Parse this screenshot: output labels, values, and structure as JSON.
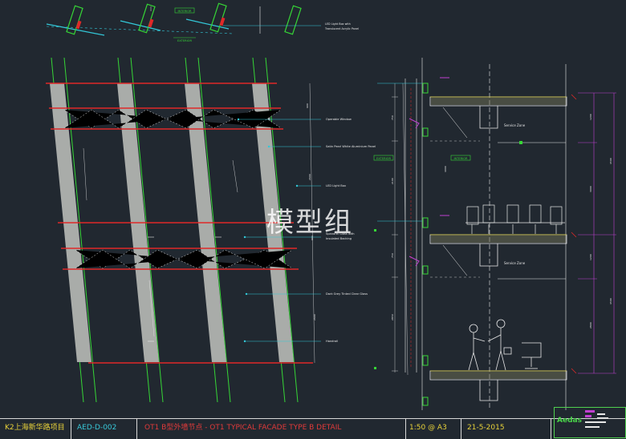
{
  "watermark": "模型组",
  "top_detail": {
    "interior_tag": "INTERIOR",
    "exterior_tag": "EXTERIOR",
    "note": [
      "LED Light Box with",
      "Translucent Acrylic Panel"
    ]
  },
  "elevation_notes": [
    "Operable Window",
    "Satin Pearl White Aluminium Panel",
    "LED Light Box",
    "Spandrel Glass with",
    "Insulated Backing",
    "Dark Grey Tinted Clear Glass",
    "Handrail"
  ],
  "section": {
    "exterior_tag": "EXTERIOR",
    "interior_tag": "INTERIOR",
    "zone_label": "Service Zone"
  },
  "title_block": {
    "project": "K2上海新华路项目",
    "drawing_no": "AED-D-002",
    "title": "OT1 B型外墙节点  -  OT1 TYPICAL FACADE TYPE B DETAIL",
    "scale": "1:50 @ A3",
    "date": "21-5-2015",
    "logo": "Aedas"
  },
  "colors": {
    "background": "#212830",
    "slab_red": "#e02828",
    "mullion_green": "#36d636",
    "panel_grey": "#a9aca9",
    "dimension_magenta": "#c040d0",
    "leader_cyan": "#33c8d8",
    "text_white": "#e8e8e8",
    "title_yellow": "#e8d23a",
    "title_red": "#e03a3a",
    "title_cyan": "#38c8d8"
  }
}
